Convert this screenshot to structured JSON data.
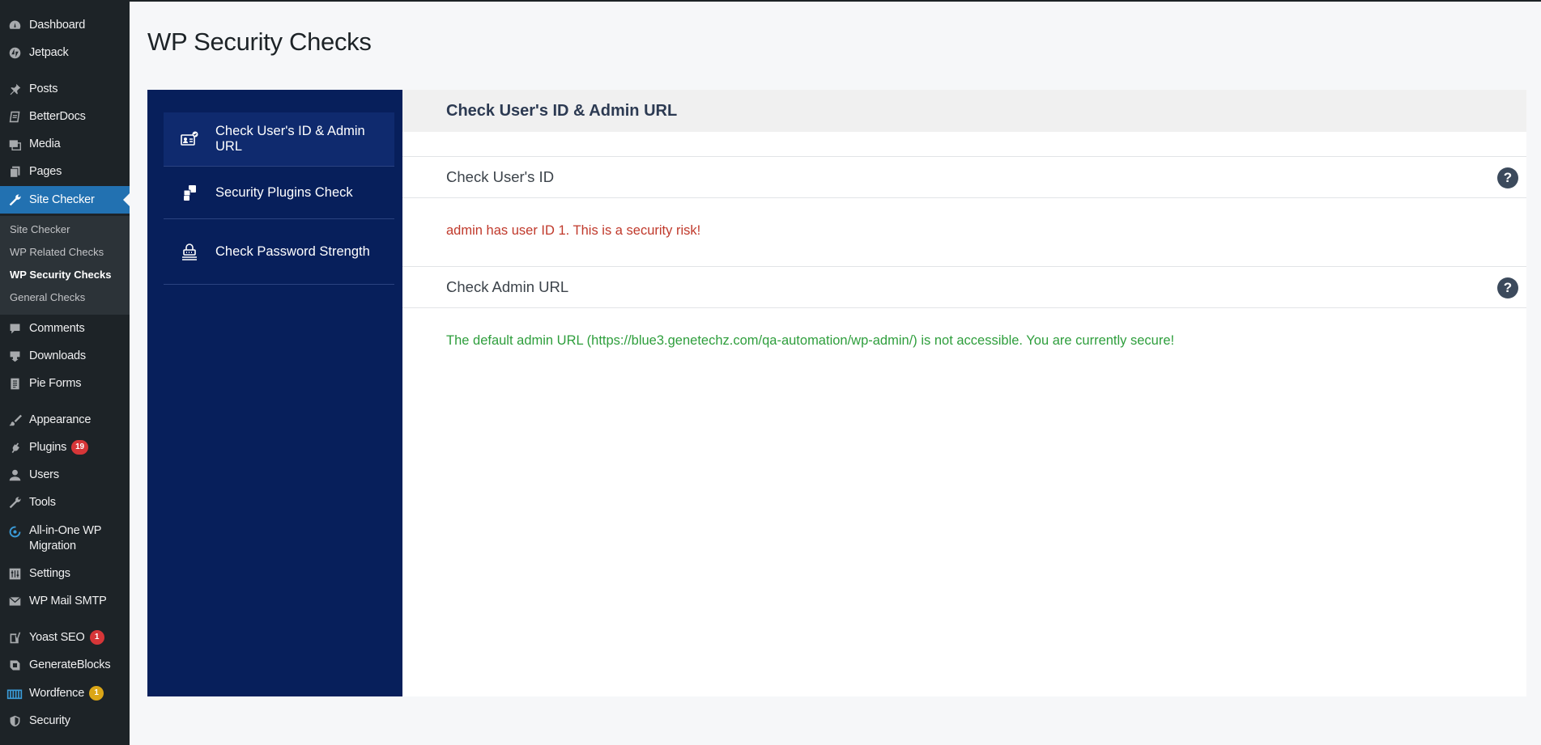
{
  "sidebar": {
    "items": [
      {
        "label": "Dashboard",
        "icon": "dashboard-icon"
      },
      {
        "label": "Jetpack",
        "icon": "jetpack-icon"
      },
      {
        "label": "Posts",
        "icon": "pin-icon"
      },
      {
        "label": "BetterDocs",
        "icon": "docs-icon"
      },
      {
        "label": "Media",
        "icon": "media-icon"
      },
      {
        "label": "Pages",
        "icon": "pages-icon"
      },
      {
        "label": "Site Checker",
        "icon": "wrench-icon"
      },
      {
        "label": "Comments",
        "icon": "comment-icon"
      },
      {
        "label": "Downloads",
        "icon": "download-icon"
      },
      {
        "label": "Pie Forms",
        "icon": "forms-icon"
      },
      {
        "label": "Appearance",
        "icon": "brush-icon"
      },
      {
        "label": "Plugins",
        "icon": "plug-icon",
        "badge": "19"
      },
      {
        "label": "Users",
        "icon": "user-icon"
      },
      {
        "label": "Tools",
        "icon": "tools-icon"
      },
      {
        "label": "All-in-One WP Migration",
        "icon": "migration-icon"
      },
      {
        "label": "Settings",
        "icon": "settings-icon"
      },
      {
        "label": "WP Mail SMTP",
        "icon": "mail-icon"
      },
      {
        "label": "Yoast SEO",
        "icon": "yoast-icon",
        "badge": "1"
      },
      {
        "label": "GenerateBlocks",
        "icon": "blocks-icon"
      },
      {
        "label": "Wordfence",
        "icon": "wordfence-icon",
        "badge": "1"
      },
      {
        "label": "Security",
        "icon": "shield-icon"
      }
    ],
    "submenu": [
      {
        "label": "Site Checker"
      },
      {
        "label": "WP Related Checks"
      },
      {
        "label": "WP Security Checks"
      },
      {
        "label": "General Checks"
      }
    ]
  },
  "page": {
    "title": "WP Security Checks"
  },
  "tabs": [
    {
      "label": "Check User's ID & Admin URL",
      "icon": "id-card-icon"
    },
    {
      "label": "Security Plugins Check",
      "icon": "plugins-blocks-icon"
    },
    {
      "label": "Check Password Strength",
      "icon": "password-lock-icon"
    }
  ],
  "content": {
    "header": "Check User's ID & Admin URL",
    "sections": [
      {
        "title": "Check User's ID",
        "help": "?",
        "message": "admin has user ID 1. This is a security risk!",
        "status_color": "#c0392b"
      },
      {
        "title": "Check Admin URL",
        "help": "?",
        "message": "The default admin URL (https://blue3.genetechz.com/qa-automation/wp-admin/) is not accessible. You are currently secure!",
        "status_color": "#2e9e3c"
      }
    ]
  },
  "colors": {
    "sidebar_bg": "#1d2327",
    "accent": "#2271b1",
    "tabnav_bg": "#071f5b",
    "badge_red": "#d63638",
    "badge_yellow": "#dba617"
  }
}
